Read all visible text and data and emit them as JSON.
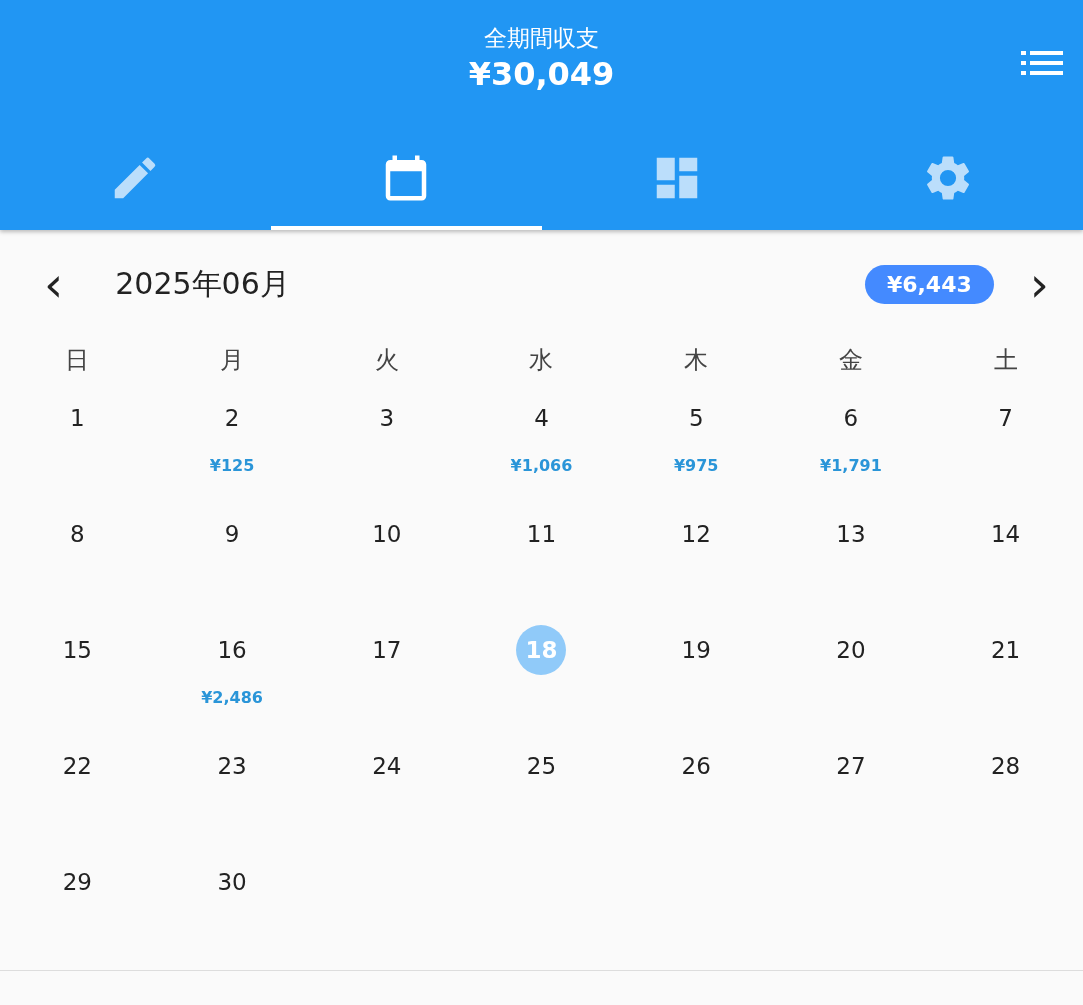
{
  "header": {
    "title": "全期間収支",
    "total": "¥30,049"
  },
  "tabs": [
    {
      "kind": "edit",
      "selected": false
    },
    {
      "kind": "calendar",
      "selected": true
    },
    {
      "kind": "dashboard",
      "selected": false
    },
    {
      "kind": "settings",
      "selected": false
    }
  ],
  "month_bar": {
    "prev": "‹",
    "month": "2025年06月",
    "balance": "¥6,443",
    "next": "›"
  },
  "weekdays": [
    "日",
    "月",
    "火",
    "水",
    "木",
    "金",
    "土"
  ],
  "days": [
    {
      "day": "1",
      "today": false
    },
    {
      "day": "2",
      "amount": "¥125",
      "today": false
    },
    {
      "day": "3",
      "today": false
    },
    {
      "day": "4",
      "amount": "¥1,066",
      "today": false
    },
    {
      "day": "5",
      "amount": "¥975",
      "today": false
    },
    {
      "day": "6",
      "amount": "¥1,791",
      "today": false
    },
    {
      "day": "7",
      "today": false
    },
    {
      "day": "8",
      "today": false
    },
    {
      "day": "9",
      "today": false
    },
    {
      "day": "10",
      "today": false
    },
    {
      "day": "11",
      "today": false
    },
    {
      "day": "12",
      "today": false
    },
    {
      "day": "13",
      "today": false
    },
    {
      "day": "14",
      "today": false
    },
    {
      "day": "15",
      "today": false
    },
    {
      "day": "16",
      "amount": "¥2,486",
      "today": false
    },
    {
      "day": "17",
      "today": false
    },
    {
      "day": "18",
      "today": true
    },
    {
      "day": "19",
      "today": false
    },
    {
      "day": "20",
      "today": false
    },
    {
      "day": "21",
      "today": false
    },
    {
      "day": "22",
      "today": false
    },
    {
      "day": "23",
      "today": false
    },
    {
      "day": "24",
      "today": false
    },
    {
      "day": "25",
      "today": false
    },
    {
      "day": "26",
      "today": false
    },
    {
      "day": "27",
      "today": false
    },
    {
      "day": "28",
      "today": false
    },
    {
      "day": "29",
      "today": false
    },
    {
      "day": "30",
      "today": false
    }
  ]
}
